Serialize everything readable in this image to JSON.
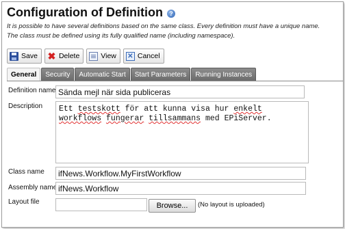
{
  "header": {
    "title": "Configuration of Definition",
    "help_icon_glyph": "?",
    "intro_line1": "It is possible to have several definitions based on the same class. Every definition must have a unique name.",
    "intro_line2": "The class must be defined using its fully qualified name (including namespace)."
  },
  "toolbar": {
    "buttons": [
      {
        "label": "Save",
        "icon": "save-icon"
      },
      {
        "label": "Delete",
        "icon": "delete-icon",
        "glyph": "✖"
      },
      {
        "label": "View",
        "icon": "view-icon"
      },
      {
        "label": "Cancel",
        "icon": "cancel-icon",
        "glyph": "✕"
      }
    ]
  },
  "tabs": [
    {
      "label": "General",
      "active": true
    },
    {
      "label": "Security",
      "active": false
    },
    {
      "label": "Automatic Start",
      "active": false
    },
    {
      "label": "Start Parameters",
      "active": false
    },
    {
      "label": "Running Instances",
      "active": false
    }
  ],
  "form": {
    "definition_name": {
      "label": "Definition name",
      "value": "Sända mejl när sida publiceras"
    },
    "description": {
      "label": "Description",
      "line1_pre": "Ett ",
      "line1_word1": "testskott",
      "line1_mid": " för att kunna visa hur ",
      "line1_word2": "enkelt",
      "line2_word1": "workflows",
      "line2_mid1": " ",
      "line2_word2": "fungerar",
      "line2_mid2": " ",
      "line2_word3": "tillsammans",
      "line2_post": " med EPiServer."
    },
    "class_name": {
      "label": "Class name",
      "value": "ifNews.Workflow.MyFirstWorkflow"
    },
    "assembly_name": {
      "label": "Assembly name",
      "value": "ifNews.Workflow"
    },
    "layout_file": {
      "label": "Layout file",
      "browse_label": "Browse...",
      "note": "(No layout is uploaded)"
    }
  },
  "colors": {
    "tab_inactive": "#7a7a7a",
    "tab_active": "#f4f4f4",
    "help_icon": "#2f64b5",
    "spell_error": "#e03030"
  }
}
